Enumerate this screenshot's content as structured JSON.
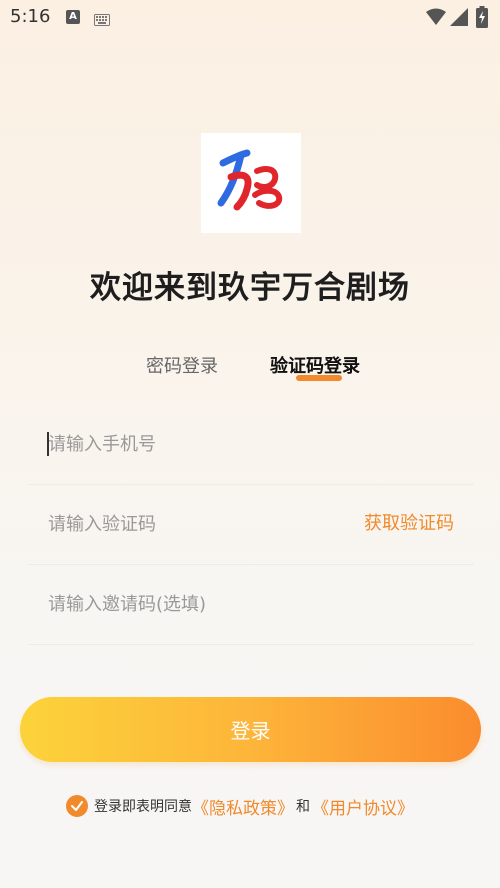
{
  "status_bar": {
    "time": "5:16",
    "icons": [
      "a-notification-icon",
      "keyboard-icon",
      "wifi-icon",
      "signal-icon",
      "battery-icon"
    ],
    "a_label": "A"
  },
  "header": {
    "title": "欢迎来到玖宇万合剧场"
  },
  "tabs": [
    {
      "label": "密码登录",
      "active": false
    },
    {
      "label": "验证码登录",
      "active": true
    }
  ],
  "form": {
    "phone_placeholder": "请输入手机号",
    "code_placeholder": "请输入验证码",
    "get_code_label": "获取验证码",
    "invite_placeholder": "请输入邀请码(选填)"
  },
  "login_button_label": "登录",
  "agreement": {
    "checked": true,
    "prefix": "登录即表明同意",
    "privacy_link": "《隐私政策》",
    "and": "和",
    "user_link": "《用户协议》"
  },
  "colors": {
    "accent": "#f08a2c",
    "button_gradient_start": "#fcd33a",
    "button_gradient_end": "#fb8c2e",
    "logo_blue": "#2e6be0",
    "logo_red": "#e0262b"
  }
}
